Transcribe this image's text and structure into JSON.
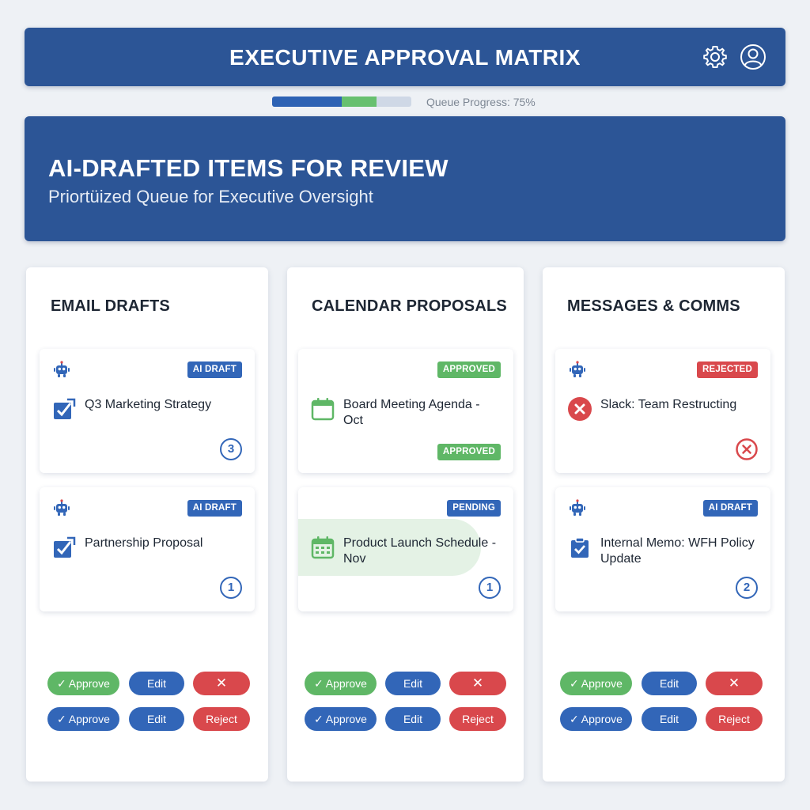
{
  "header": {
    "title": "EXECUTIVE APPROVAL MATRIX",
    "icons": [
      "gear-icon",
      "user-avatar-icon"
    ]
  },
  "progress": {
    "label": "Queue Progress: 75%",
    "value": 75
  },
  "hero": {
    "title": "AI-DRAFTED ITEMS FOR REVIEW",
    "subtitle": "Priortüized Queue for Executive Oversight"
  },
  "columns": [
    {
      "title": "EMAIL DRAFTS",
      "cards": [
        {
          "badge": "AI DRAFT",
          "label": "Q3 Marketing Strategy",
          "priority": "3"
        },
        {
          "badge": "AI DRAFT",
          "label": "Partnership Proposal",
          "priority": "1"
        }
      ]
    },
    {
      "title": "CALENDAR PROPOSALS",
      "cards": [
        {
          "badge": "APPROVED",
          "label": "Board Meeting Agenda - Oct",
          "badge_bottom": "APPROVED"
        },
        {
          "badge": "PENDING",
          "label": "Product Launch Schedule - Nov",
          "priority": "1"
        }
      ]
    },
    {
      "title": "MESSAGES & COMMS",
      "cards": [
        {
          "badge": "REJECTED",
          "label": "Slack: Team Restructing"
        },
        {
          "badge": "AI DRAFT",
          "label": "Internal Memo: WFH Policy Update",
          "priority": "2"
        }
      ]
    }
  ],
  "actions": {
    "approve": "Approve",
    "edit": "Edit",
    "reject": "Reject",
    "reject_x": "✕",
    "check": "✓"
  },
  "colors": {
    "primary": "#2c5596",
    "accent_blue": "#3266b8",
    "approve_green": "#5fb766",
    "reject_red": "#d9484c",
    "background": "#eef1f5"
  }
}
